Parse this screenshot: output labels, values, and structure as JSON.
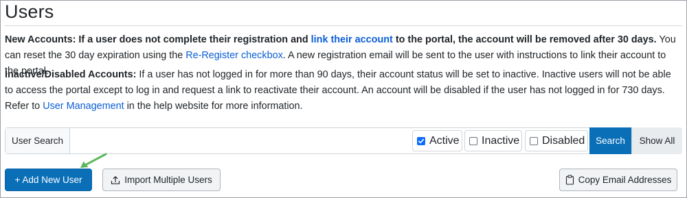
{
  "page": {
    "title": "Users"
  },
  "notice_new": {
    "label": "New Accounts:",
    "text1": " If a user does not complete their registration and ",
    "link1": "link their account",
    "text2": " to the portal, the account will be removed after 30 days.",
    "text3": " You can reset the 30 day expiration using the ",
    "link2": "Re-Register checkbox",
    "text4": ". A new registration email will be sent to the user with instructions to link their account to the portal."
  },
  "notice_inactive": {
    "label": "Inactive/Disabled Accounts:",
    "text1": " If a user has not logged in for more than 90 days, their account status will be set to inactive. Inactive users will not be able to access the portal except to log in and request a link to reactivate their account. An account will be disabled if the user has not logged in for 730 days. Refer to ",
    "link1": "User Management",
    "text2": " in the help website for more information."
  },
  "search": {
    "label": "User Search",
    "value": "",
    "filters": {
      "active": {
        "label": "Active",
        "checked": true
      },
      "inactive": {
        "label": "Inactive",
        "checked": false
      },
      "disabled": {
        "label": "Disabled",
        "checked": false
      }
    },
    "search_button": "Search",
    "show_all_button": "Show All"
  },
  "actions": {
    "add_new_user": "+ Add New User",
    "import_multiple_users": "Import Multiple Users",
    "copy_email_addresses": "Copy Email Addresses"
  },
  "colors": {
    "primary": "#0b6fb8",
    "link": "#0b5ed7",
    "annotation_arrow": "#5cb85c"
  }
}
